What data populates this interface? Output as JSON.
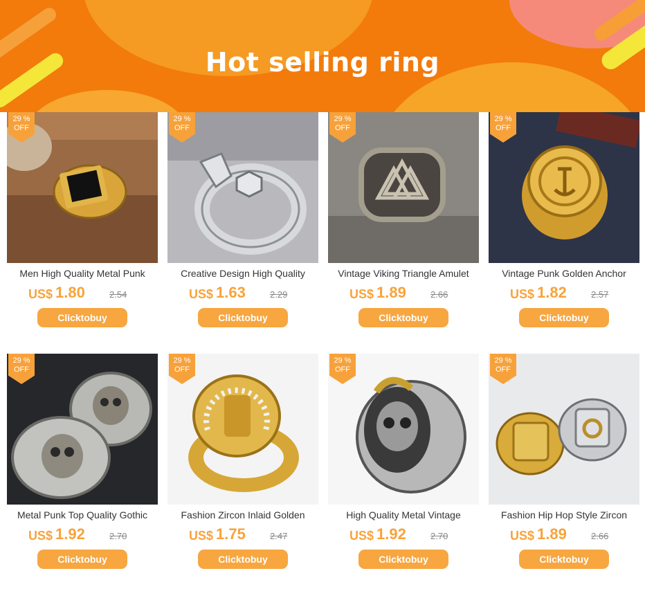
{
  "banner": {
    "title": "Hot selling ring"
  },
  "colors": {
    "accent": "#f7a33a",
    "banner": "#f27b0c",
    "button": "#f7a640"
  },
  "products": [
    {
      "badge_line1": "29 %",
      "badge_line2": "OFF",
      "name": "Men High Quality Metal Punk",
      "currency": "US$",
      "price": "1.80",
      "old_price": "2.54",
      "button": "Clicktobuy"
    },
    {
      "badge_line1": "29 %",
      "badge_line2": "OFF",
      "name": "Creative Design High Quality",
      "currency": "US$",
      "price": "1.63",
      "old_price": "2.29",
      "button": "Clicktobuy"
    },
    {
      "badge_line1": "29 %",
      "badge_line2": "OFF",
      "name": "Vintage Viking Triangle Amulet",
      "currency": "US$",
      "price": "1.89",
      "old_price": "2.66",
      "button": "Clicktobuy"
    },
    {
      "badge_line1": "29 %",
      "badge_line2": "OFF",
      "name": "Vintage Punk Golden Anchor",
      "currency": "US$",
      "price": "1.82",
      "old_price": "2.57",
      "button": "Clicktobuy"
    },
    {
      "badge_line1": "29 %",
      "badge_line2": "OFF",
      "name": "Metal Punk Top Quality Gothic",
      "currency": "US$",
      "price": "1.92",
      "old_price": "2.70",
      "button": "Clicktobuy"
    },
    {
      "badge_line1": "29 %",
      "badge_line2": "OFF",
      "name": "Fashion Zircon Inlaid Golden",
      "currency": "US$",
      "price": "1.75",
      "old_price": "2.47",
      "button": "Clicktobuy"
    },
    {
      "badge_line1": "29 %",
      "badge_line2": "OFF",
      "name": "High Quality Metal Vintage",
      "currency": "US$",
      "price": "1.92",
      "old_price": "2.70",
      "button": "Clicktobuy"
    },
    {
      "badge_line1": "29 %",
      "badge_line2": "OFF",
      "name": "Fashion Hip Hop Style Zircon",
      "currency": "US$",
      "price": "1.89",
      "old_price": "2.66",
      "button": "Clicktobuy"
    }
  ]
}
